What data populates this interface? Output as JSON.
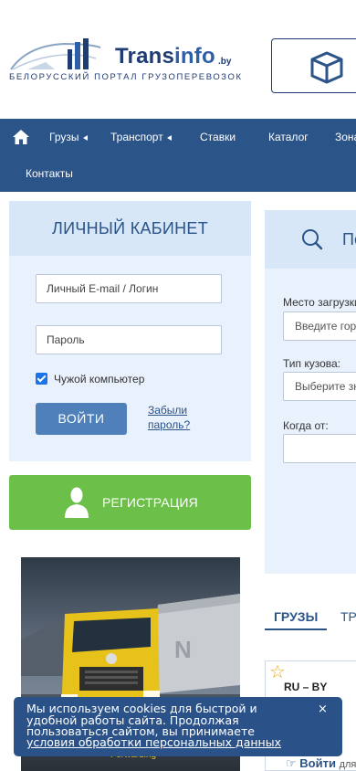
{
  "header": {
    "logo_name_primary": "Trans",
    "logo_name_accent": "info",
    "logo_domain": ".by",
    "logo_tagline": "БЕЛОРУССКИЙ ПОРТАЛ ГРУЗОПЕРЕВОЗОК",
    "box_icon": "cube-icon"
  },
  "nav": {
    "home_icon": "home-icon",
    "items": [
      {
        "label": "Грузы",
        "has_submenu": true
      },
      {
        "label": "Транспорт",
        "has_submenu": true
      },
      {
        "label": "Ставки",
        "has_submenu": false
      },
      {
        "label": "Каталог",
        "has_submenu": false
      },
      {
        "label": "Зона",
        "has_submenu": false
      },
      {
        "label": "Контакты",
        "has_submenu": false
      }
    ]
  },
  "login": {
    "title": "ЛИЧНЫЙ КАБИНЕТ",
    "login_placeholder": "Личный E-mail / Логин",
    "password_placeholder": "Пароль",
    "remember_label": "Чужой компьютер",
    "remember_checked": true,
    "submit_label": "ВОЙТИ",
    "forgot_label": "Забыли пароль?"
  },
  "register": {
    "label": "РЕГИСТРАЦИЯ",
    "icon": "user-icon"
  },
  "ad": {
    "caption": "Forwarding"
  },
  "search": {
    "title": "По",
    "icon": "search-icon",
    "fields": [
      {
        "label": "Место загрузки",
        "placeholder": "Введите город"
      },
      {
        "label": "Тип кузова:",
        "placeholder": "Выберите значение"
      },
      {
        "label": "Когда от:",
        "placeholder": ""
      }
    ]
  },
  "tabs": [
    {
      "label": "ГРУЗЫ",
      "active": true
    },
    {
      "label": "ТРАНСПОРТ",
      "active": false
    }
  ],
  "card": {
    "star_icon": "star-icon",
    "route": "RU – BY",
    "login_label": "Войти",
    "login_suffix": "для",
    "login_icon": "hand-pointer-icon"
  },
  "cookie": {
    "text": "Мы используем cookies для быстрой и удобной работы сайта. Продолжая пользоваться сайтом, вы принимаете",
    "link_label": "условия обработки персональных данных",
    "close_label": "×"
  },
  "colors": {
    "nav_bg": "#2b5488",
    "panel_bg": "#e9f1fc",
    "panel_head_bg": "#d8e7f8",
    "register_green": "#6cc04a",
    "login_btn": "#4f80b9",
    "cookie_bg": "#2a5289"
  }
}
